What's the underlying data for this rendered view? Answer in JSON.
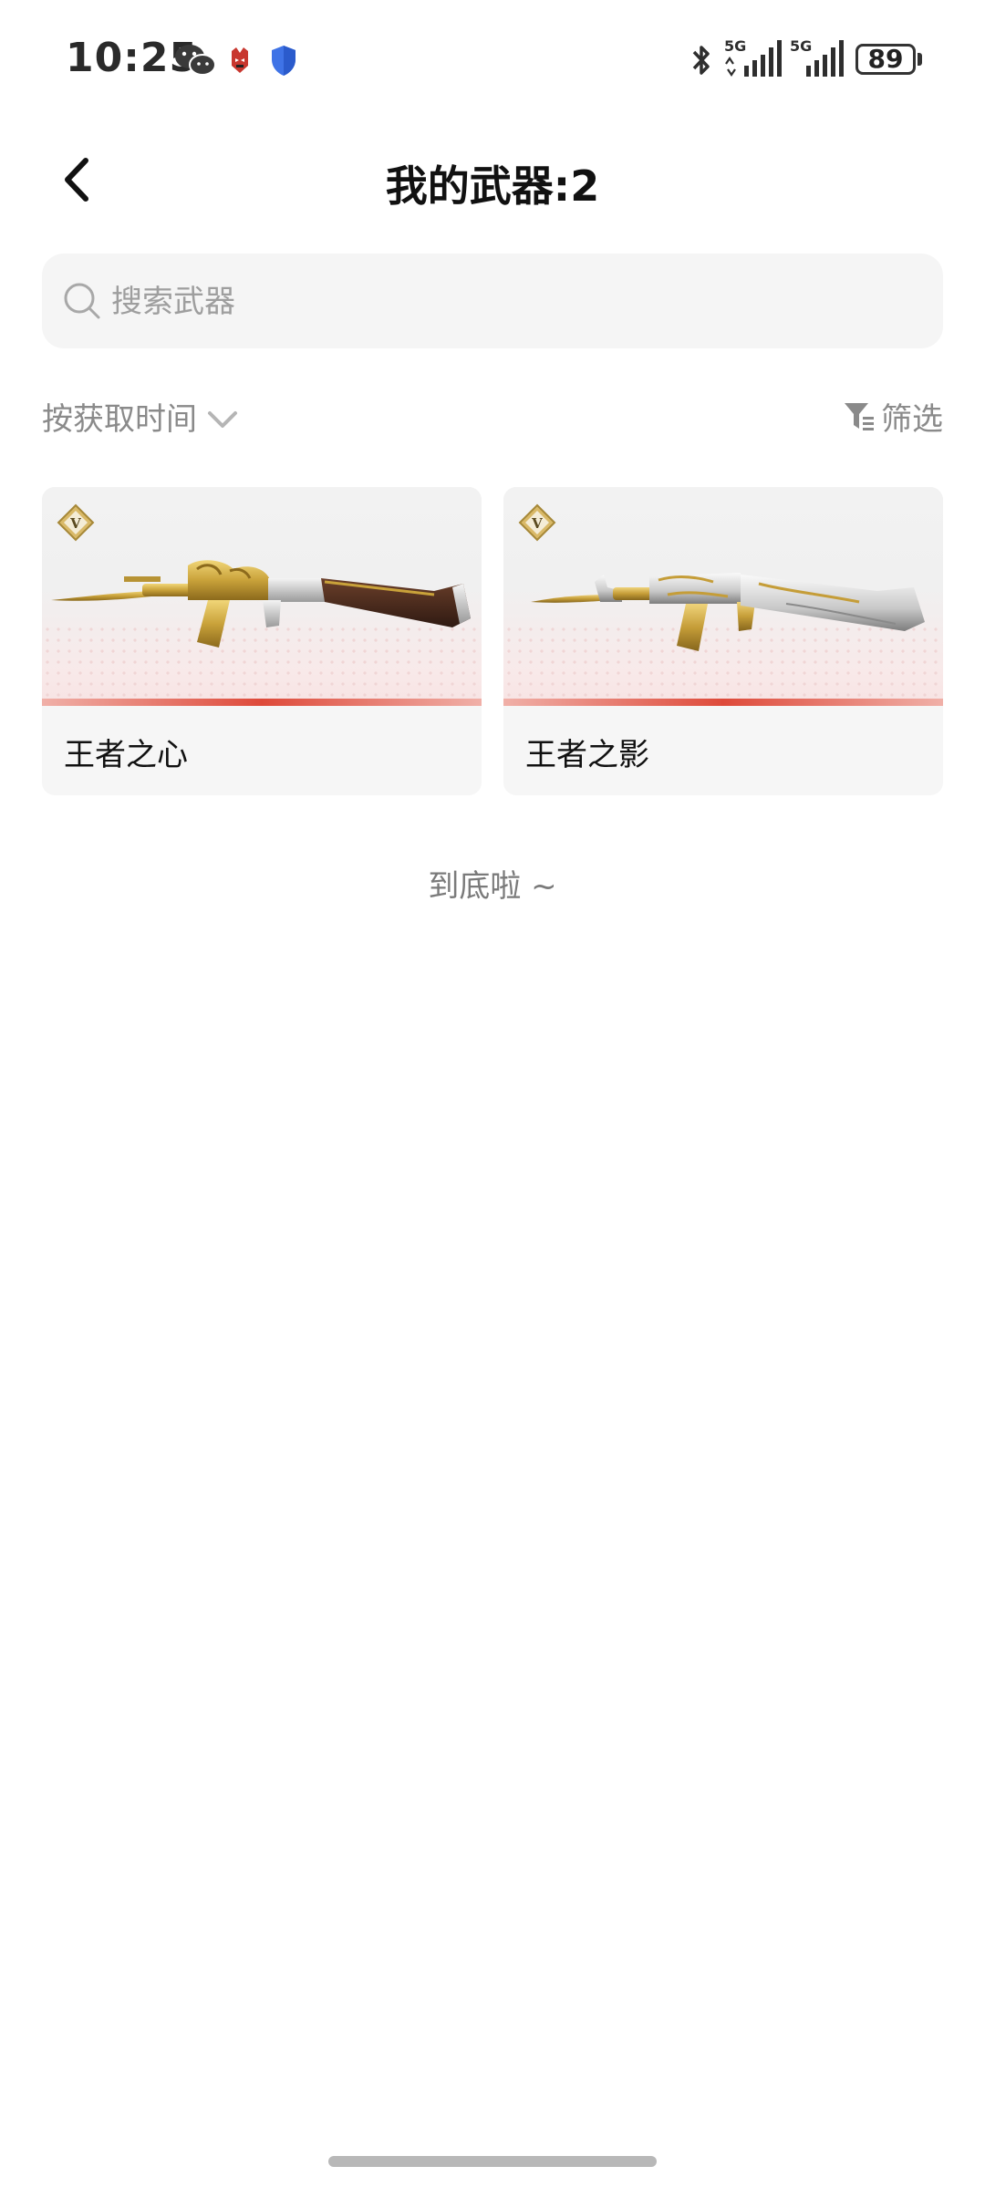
{
  "status_bar": {
    "time": "10:25",
    "network_1": "5G",
    "network_2": "5G",
    "battery": "89",
    "icons": [
      "wechat-icon",
      "app-icon",
      "shield-icon",
      "bluetooth-icon",
      "signal-icon",
      "signal-icon",
      "battery-icon"
    ]
  },
  "header": {
    "title": "我的武器:2",
    "back_icon": "chevron-left-icon"
  },
  "search": {
    "placeholder": "搜索武器",
    "value": "",
    "icon": "search-icon"
  },
  "sort": {
    "label": "按获取时间",
    "icon": "chevron-down-icon"
  },
  "filter": {
    "label": "筛选",
    "icon": "filter-icon"
  },
  "weapons": [
    {
      "name": "王者之心",
      "badge": "V",
      "image": "rifle-image"
    },
    {
      "name": "王者之影",
      "badge": "V",
      "image": "rifle-image"
    }
  ],
  "list_end": "到底啦 ~",
  "colors": {
    "accent_red": "#de4a3a",
    "card_bg": "#f6f6f6",
    "muted_text": "#8a8a8a",
    "gold": "#c9a23a"
  }
}
